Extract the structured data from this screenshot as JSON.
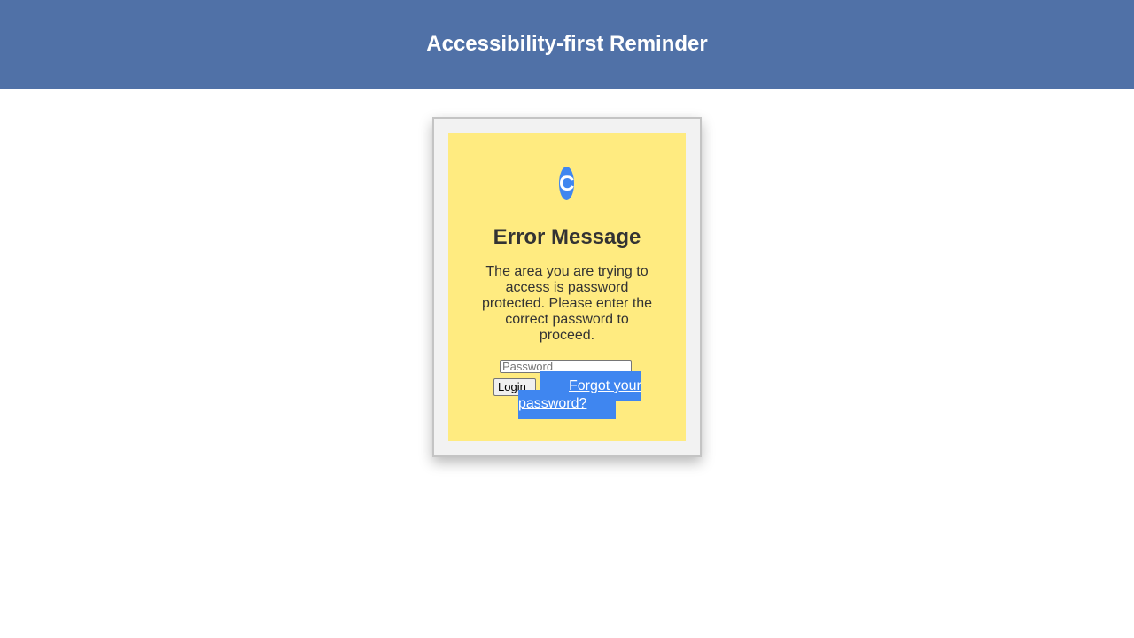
{
  "header": {
    "title": "Accessibility-first Reminder"
  },
  "card": {
    "avatar_letter": "C",
    "title": "Error Message",
    "message": "The area you are trying to access is password protected. Please enter the correct password to proceed.",
    "password_placeholder": "Password",
    "login_label": "Login",
    "forgot_label": "Forgot your password?"
  },
  "colors": {
    "header_bg": "#5071a7",
    "card_bg": "#ffeb80",
    "accent": "#3f86f0",
    "text": "#333333"
  }
}
